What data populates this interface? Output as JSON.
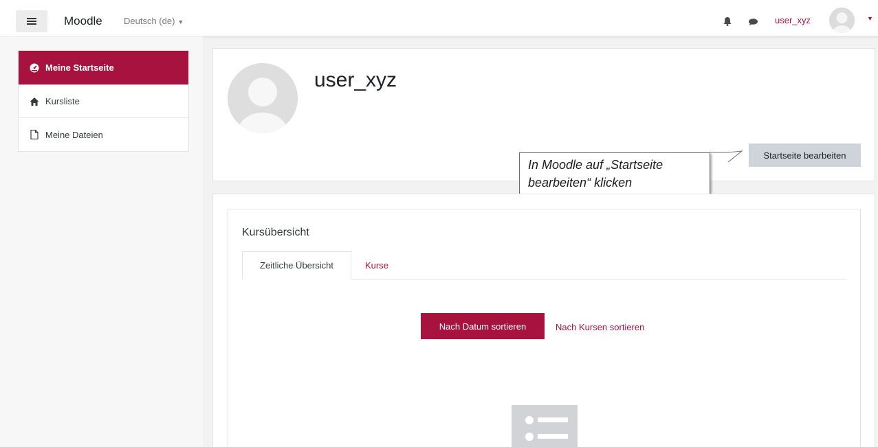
{
  "navbar": {
    "brand": "Moodle",
    "language": "Deutsch (de)",
    "username": "user_xyz"
  },
  "sidebar": {
    "items": [
      {
        "label": "Meine Startseite",
        "icon": "dashboard-icon",
        "active": true
      },
      {
        "label": "Kursliste",
        "icon": "home-icon",
        "active": false
      },
      {
        "label": "Meine Dateien",
        "icon": "file-icon",
        "active": false
      }
    ]
  },
  "header": {
    "title": "user_xyz",
    "edit_button": "Startseite bearbeiten"
  },
  "callout": {
    "line1": "In Moodle auf „Startseite",
    "line2": "bearbeiten“ klicken"
  },
  "course_overview": {
    "title": "Kursübersicht",
    "tabs": [
      {
        "label": "Zeitliche Übersicht",
        "active": true
      },
      {
        "label": "Kurse",
        "active": false
      }
    ],
    "sort_by_date": "Nach Datum sortieren",
    "sort_by_course": "Nach Kursen sortieren"
  },
  "colors": {
    "accent": "#a8123e",
    "button_gray": "#ced4da",
    "background": "#f2f2f2"
  }
}
